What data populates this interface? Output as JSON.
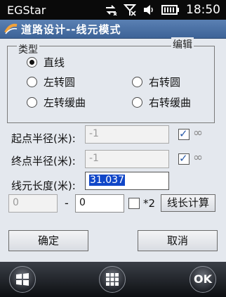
{
  "status_bar": {
    "app_name": "EGStar",
    "time": "18:50",
    "icons": [
      "sync-arrows-icon",
      "no-signal-icon",
      "speaker-icon",
      "battery-icon"
    ]
  },
  "title_bar": {
    "title": "道路设计--线元模式",
    "icon": "road-logo-icon",
    "accent": "#3d6397"
  },
  "type_group": {
    "legend": "类型",
    "side_label": "编辑",
    "options": [
      {
        "label": "直线",
        "checked": true
      },
      {
        "label": "左转圆",
        "checked": false
      },
      {
        "label": "右转圆",
        "checked": false
      },
      {
        "label": "左转缓曲",
        "checked": false
      },
      {
        "label": "右转缓曲",
        "checked": false
      }
    ]
  },
  "fields": {
    "start_radius": {
      "label": "起点半径(米):",
      "value": "-1",
      "infinity_checked": true,
      "infinity_symbol": "∞"
    },
    "end_radius": {
      "label": "终点半径(米):",
      "value": "-1",
      "infinity_checked": true,
      "infinity_symbol": "∞"
    },
    "length": {
      "label": "线元长度(米):",
      "value": "31.037"
    }
  },
  "calc_row": {
    "from_value": "0",
    "separator": "-",
    "to_value": "0",
    "multiplier_label": "*2",
    "times2_checked": false,
    "calc_button": "线长计算"
  },
  "actions": {
    "ok": "确定",
    "cancel": "取消"
  },
  "softkeys": {
    "left": "windows-start-icon",
    "center": "keyboard-grid-icon",
    "right": "OK"
  }
}
